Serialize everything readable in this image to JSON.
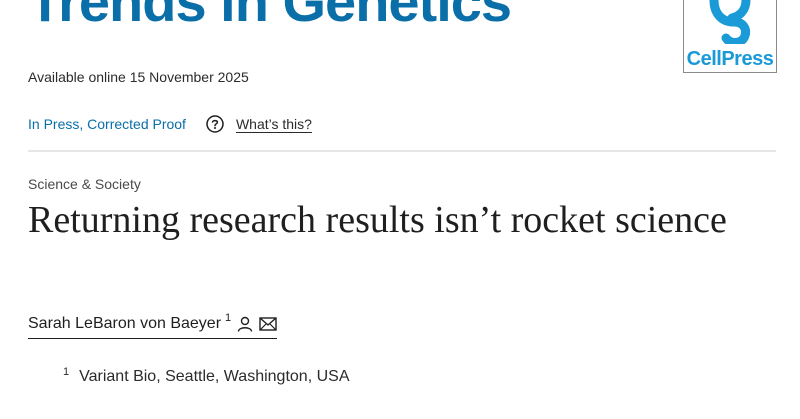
{
  "journal": {
    "title": "Trends in Genetics"
  },
  "publisher": {
    "name": "CellPress"
  },
  "article_info": {
    "available": "Available online 15 November 2025",
    "status": "In Press, Corrected Proof",
    "whats_this": "What’s this?"
  },
  "article": {
    "section": "Science & Society",
    "title": "Returning research results isn’t rocket science"
  },
  "authors": [
    {
      "name": "Sarah LeBaron von Baeyer",
      "affiliation_ref": "1"
    }
  ],
  "affiliations": [
    {
      "ref": "1",
      "text": "Variant Bio, Seattle, Washington, USA"
    }
  ],
  "colors": {
    "brand": "#0a6ea8",
    "cellpress": "#1a9ad6"
  },
  "icons": [
    "help-icon",
    "person-icon",
    "mail-icon",
    "cellpress-logo-icon"
  ]
}
